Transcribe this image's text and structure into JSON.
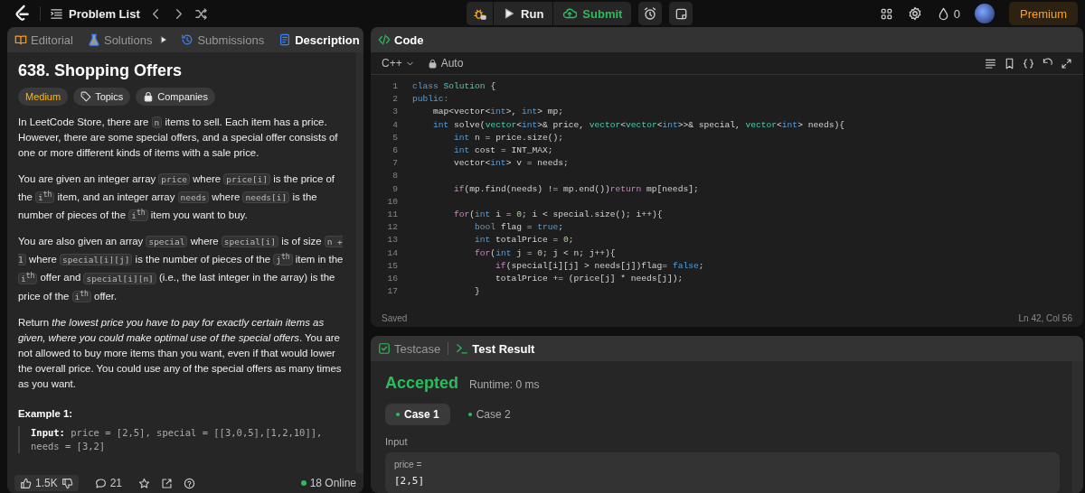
{
  "top_bar": {
    "problem_list": "Problem List",
    "run": "Run",
    "submit": "Submit",
    "streak": "0",
    "premium": "Premium"
  },
  "left_panel": {
    "tabs": [
      {
        "label": "Editorial",
        "kind": "editorial",
        "selected": false
      },
      {
        "label": "Solutions",
        "kind": "solutions",
        "selected": false
      },
      {
        "label": "Submissions",
        "kind": "submissions",
        "selected": false
      },
      {
        "label": "Description",
        "kind": "description",
        "selected": true
      }
    ],
    "title": "638. Shopping Offers",
    "tags": [
      {
        "label": "Medium",
        "kind": "difficulty"
      },
      {
        "label": "Topics",
        "kind": "topics"
      },
      {
        "label": "Companies",
        "kind": "companies"
      }
    ],
    "paragraphs": [
      [
        {
          "kind": "text",
          "text": "In LeetCode Store, there are "
        },
        {
          "kind": "code",
          "text": "n"
        },
        {
          "kind": "text",
          "text": " items to sell. Each item has a price. However, there are some special offers, and a special offer consists of one or more different kinds of items with a sale price."
        }
      ],
      [
        {
          "kind": "text",
          "text": "You are given an integer array "
        },
        {
          "kind": "code",
          "text": "price"
        },
        {
          "kind": "text",
          "text": " where "
        },
        {
          "kind": "code",
          "text": "price[i]"
        },
        {
          "kind": "text",
          "text": " is the price of the "
        },
        {
          "kind": "code",
          "text": "i$^{th}$"
        },
        {
          "kind": "text",
          "text": " item, and an integer array "
        },
        {
          "kind": "code",
          "text": "needs"
        },
        {
          "kind": "text",
          "text": " where "
        },
        {
          "kind": "code",
          "text": "needs[i]"
        },
        {
          "kind": "text",
          "text": " is the number of pieces of the "
        },
        {
          "kind": "code",
          "text": "i$^{th}$"
        },
        {
          "kind": "text",
          "text": " item you want to buy."
        }
      ],
      [
        {
          "kind": "text",
          "text": "You are also given an array "
        },
        {
          "kind": "code",
          "text": "special"
        },
        {
          "kind": "text",
          "text": " where "
        },
        {
          "kind": "code",
          "text": "special[i]"
        },
        {
          "kind": "text",
          "text": " is of size "
        },
        {
          "kind": "code",
          "text": "n + 1"
        },
        {
          "kind": "text",
          "text": " where "
        },
        {
          "kind": "code",
          "text": "special[i][j]"
        },
        {
          "kind": "text",
          "text": " is the number of pieces of the "
        },
        {
          "kind": "code",
          "text": "j$^{th}$"
        },
        {
          "kind": "text",
          "text": " item in the "
        },
        {
          "kind": "code",
          "text": "i$^{th}$"
        },
        {
          "kind": "text",
          "text": " offer and "
        },
        {
          "kind": "code",
          "text": "special[i][n]"
        },
        {
          "kind": "text",
          "text": " (i.e., the last integer in the array) is the price of the "
        },
        {
          "kind": "code",
          "text": "i$^{th}$"
        },
        {
          "kind": "text",
          "text": " offer."
        }
      ],
      [
        {
          "kind": "text",
          "text": "Return *the lowest price you have to pay for exactly certain items as given, where you could make optimal use of the special offers*. You are not allowed to buy more items than you want, even if that would lower the overall price. You could use any of the special offers as many times as you want."
        }
      ]
    ],
    "example": {
      "title": "Example 1:",
      "input": "**Input:** price = [2,5], special = [[3,0,5],[1,2,10]], needs = [3,2]"
    },
    "footer": {
      "likes": "1.5K",
      "comments": "21",
      "online": "18 Online"
    }
  },
  "code_panel": {
    "title": "Code",
    "language": "C++",
    "mode": "Auto",
    "lines": [
      {
        "number": "1",
        "tokens": [
          {
            "text": "class",
            "kind": "k"
          },
          {
            "text": " Solution",
            "kind": "t"
          },
          {
            "text": " {",
            "kind": "p"
          }
        ]
      },
      {
        "number": "2",
        "tokens": [
          {
            "text": "public:",
            "kind": "k"
          }
        ]
      },
      {
        "number": "3",
        "tokens": [
          {
            "text": "    map<vector<",
            "kind": "p"
          },
          {
            "text": "int",
            "kind": "k"
          },
          {
            "text": ">, ",
            "kind": "p"
          },
          {
            "text": "int",
            "kind": "k"
          },
          {
            "text": "> mp;",
            "kind": "p"
          }
        ]
      },
      {
        "number": "4",
        "tokens": [
          {
            "text": "    int",
            "kind": "k"
          },
          {
            "text": " solve(",
            "kind": "p"
          },
          {
            "text": "vector",
            "kind": "t"
          },
          {
            "text": "<",
            "kind": "p"
          },
          {
            "text": "int",
            "kind": "k"
          },
          {
            "text": ">& price, ",
            "kind": "p"
          },
          {
            "text": "vector",
            "kind": "t"
          },
          {
            "text": "<",
            "kind": "p"
          },
          {
            "text": "vector",
            "kind": "t"
          },
          {
            "text": "<",
            "kind": "p"
          },
          {
            "text": "int",
            "kind": "k"
          },
          {
            "text": ">>& special, ",
            "kind": "p"
          },
          {
            "text": "vector",
            "kind": "t"
          },
          {
            "text": "<",
            "kind": "p"
          },
          {
            "text": "int",
            "kind": "k"
          },
          {
            "text": "> needs){",
            "kind": "p"
          }
        ]
      },
      {
        "number": "5",
        "tokens": [
          {
            "text": "        int",
            "kind": "k"
          },
          {
            "text": " n = price.size();",
            "kind": "p"
          }
        ]
      },
      {
        "number": "6",
        "tokens": [
          {
            "text": "        int",
            "kind": "k"
          },
          {
            "text": " cost = INT_MAX;",
            "kind": "p"
          }
        ]
      },
      {
        "number": "7",
        "tokens": [
          {
            "text": "        vector<",
            "kind": "p"
          },
          {
            "text": "int",
            "kind": "k"
          },
          {
            "text": "> v = needs;",
            "kind": "p"
          }
        ]
      },
      {
        "number": "8"
      },
      {
        "number": "9",
        "tokens": [
          {
            "text": "        if",
            "kind": "c"
          },
          {
            "text": "(mp.find(needs) != mp.end())",
            "kind": "p"
          },
          {
            "text": "return",
            "kind": "c"
          },
          {
            "text": " mp[needs];",
            "kind": "p"
          }
        ]
      },
      {
        "number": "10"
      },
      {
        "number": "11",
        "tokens": [
          {
            "text": "        for",
            "kind": "c"
          },
          {
            "text": "(",
            "kind": "p"
          },
          {
            "text": "int",
            "kind": "k"
          },
          {
            "text": " i = ",
            "kind": "p"
          },
          {
            "text": "0",
            "kind": "n"
          },
          {
            "text": "; i < special.size(); i++){",
            "kind": "p"
          }
        ]
      },
      {
        "number": "12",
        "tokens": [
          {
            "text": "            bool",
            "kind": "k"
          },
          {
            "text": " flag = ",
            "kind": "p"
          },
          {
            "text": "true",
            "kind": "k"
          },
          {
            "text": ";",
            "kind": "p"
          }
        ]
      },
      {
        "number": "13",
        "tokens": [
          {
            "text": "            int",
            "kind": "k"
          },
          {
            "text": " totalPrice = ",
            "kind": "p"
          },
          {
            "text": "0",
            "kind": "n"
          },
          {
            "text": ";",
            "kind": "p"
          }
        ]
      },
      {
        "number": "14",
        "tokens": [
          {
            "text": "            for",
            "kind": "c"
          },
          {
            "text": "(",
            "kind": "p"
          },
          {
            "text": "int",
            "kind": "k"
          },
          {
            "text": " j = ",
            "kind": "p"
          },
          {
            "text": "0",
            "kind": "n"
          },
          {
            "text": "; j < n; j++){",
            "kind": "p"
          }
        ]
      },
      {
        "number": "15",
        "tokens": [
          {
            "text": "                if",
            "kind": "c"
          },
          {
            "text": "(special[i][j] > needs[j])flag= ",
            "kind": "p"
          },
          {
            "text": "false",
            "kind": "k"
          },
          {
            "text": ";",
            "kind": "p"
          }
        ]
      },
      {
        "number": "16",
        "tokens": [
          {
            "text": "                totalPrice += (price[j] * needs[j]);",
            "kind": "p"
          }
        ]
      },
      {
        "number": "17",
        "tokens": [
          {
            "text": "            }",
            "kind": "p"
          }
        ]
      }
    ],
    "status": "Saved",
    "cursor": "Ln 42, Col 56"
  },
  "result_panel": {
    "tabs": [
      {
        "label": "Testcase",
        "kind": "testcase",
        "selected": false
      },
      {
        "label": "Test Result",
        "kind": "result",
        "selected": true
      }
    ],
    "verdict": "Accepted",
    "runtime": "Runtime: 0 ms",
    "cases": [
      {
        "label": "Case 1",
        "selected": true
      },
      {
        "label": "Case 2",
        "selected": false
      }
    ],
    "input_label": "Input",
    "param_name": "price =",
    "param_value": "[2,5]"
  }
}
